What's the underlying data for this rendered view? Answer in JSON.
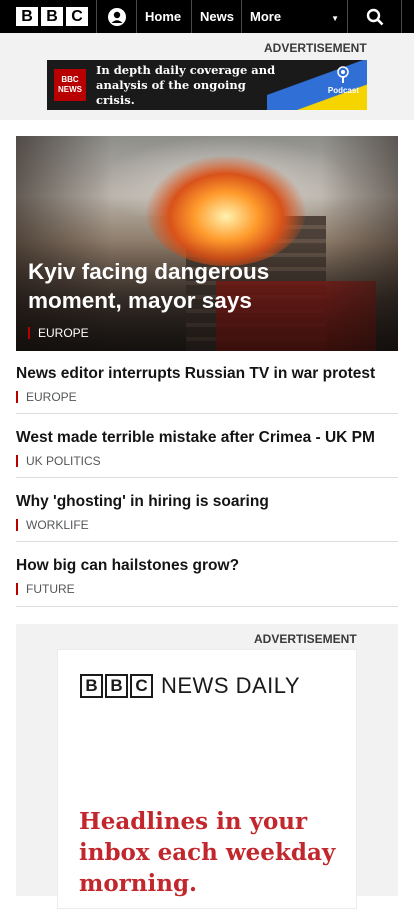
{
  "header": {
    "logo_letters": [
      "B",
      "B",
      "C"
    ],
    "nav": {
      "home": "Home",
      "news": "News",
      "more": "More"
    },
    "icons": [
      "account-icon",
      "search-icon",
      "chevron-down-icon"
    ]
  },
  "ad_top": {
    "label": "ADVERTISEMENT",
    "logo_line1": "BBC",
    "logo_line2": "NEWS",
    "text": "In depth daily coverage and analysis of the ongoing crisis.",
    "podcast": "Podcast"
  },
  "hero": {
    "title": "Kyiv facing dangerous moment, mayor says",
    "tag": "EUROPE"
  },
  "stories": [
    {
      "title": "News editor interrupts Russian TV in war protest",
      "tag": "EUROPE"
    },
    {
      "title": "West made terrible mistake after Crimea - UK PM",
      "tag": "UK POLITICS"
    },
    {
      "title": "Why 'ghosting' in hiring is soaring",
      "tag": "WORKLIFE"
    },
    {
      "title": "How big can hailstones grow?",
      "tag": "FUTURE"
    }
  ],
  "ad_bottom": {
    "label": "ADVERTISEMENT",
    "logo_letters": [
      "B",
      "B",
      "C"
    ],
    "logo_text": "NEWS DAILY",
    "headline": "Headlines in your inbox each weekday morning."
  },
  "colors": {
    "accent": "#b80000",
    "headline_red": "#c1272d",
    "ad_bg": "#f2f2f2"
  }
}
